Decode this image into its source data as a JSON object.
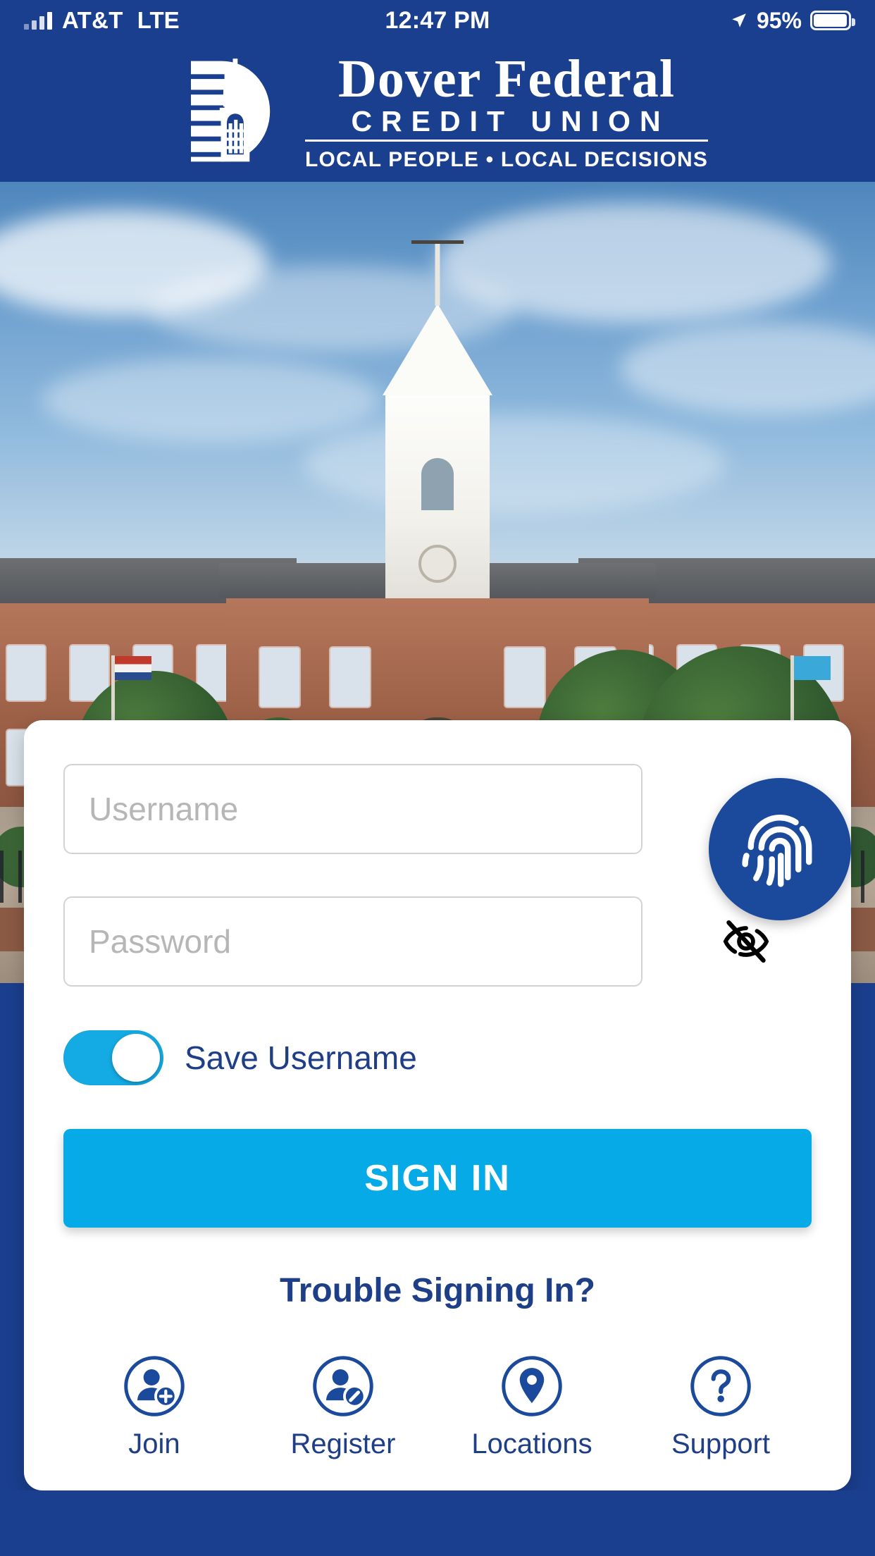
{
  "status_bar": {
    "carrier": "AT&T",
    "network": "LTE",
    "time": "12:47 PM",
    "battery_percent": "95%",
    "location_icon": "location-arrow-icon",
    "signal_icon": "cellular-signal-icon",
    "battery_icon": "battery-icon"
  },
  "header": {
    "brand_name": "Dover Federal",
    "brand_sub": "CREDIT UNION",
    "tagline": "LOCAL PEOPLE • LOCAL DECISIONS",
    "logo_icon": "dover-federal-logo-icon"
  },
  "hero": {
    "alt": "Delaware Legislative Hall building photo"
  },
  "login": {
    "username_placeholder": "Username",
    "username_value": "",
    "password_placeholder": "Password",
    "password_value": "",
    "eye_icon": "eye-off-icon",
    "fingerprint_icon": "fingerprint-icon",
    "save_username_label": "Save Username",
    "save_username_on": true,
    "sign_in_label": "SIGN IN",
    "trouble_label": "Trouble Signing In?"
  },
  "quick_links": [
    {
      "label": "Join",
      "icon": "person-add-icon"
    },
    {
      "label": "Register",
      "icon": "person-edit-icon"
    },
    {
      "label": "Locations",
      "icon": "map-pin-icon"
    },
    {
      "label": "Support",
      "icon": "question-mark-icon"
    }
  ],
  "colors": {
    "brand_navy": "#1b3f8f",
    "logo_navy": "#1b4a9c",
    "accent_cyan": "#05aae6",
    "toggle_on": "#14aae4",
    "text_navy": "#1e3f87",
    "input_border": "#d3d3d3",
    "placeholder": "#b6b6b6"
  }
}
